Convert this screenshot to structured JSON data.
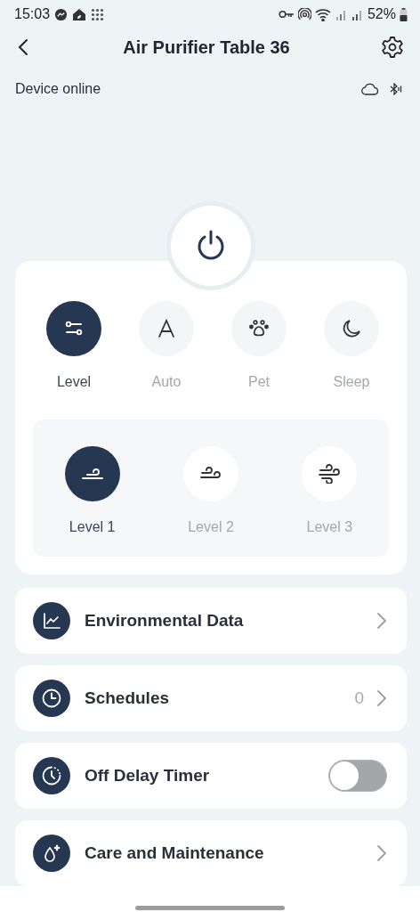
{
  "status_bar": {
    "time": "15:03",
    "battery": "52%"
  },
  "header": {
    "title": "Air Purifier Table 36"
  },
  "device": {
    "status": "Device online"
  },
  "modes": [
    {
      "label": "Level",
      "kind": "level",
      "selected": true
    },
    {
      "label": "Auto",
      "kind": "auto",
      "selected": false
    },
    {
      "label": "Pet",
      "kind": "pet",
      "selected": false
    },
    {
      "label": "Sleep",
      "kind": "sleep",
      "selected": false
    }
  ],
  "levels": [
    {
      "label": "Level 1",
      "kind": "wind1",
      "selected": true
    },
    {
      "label": "Level 2",
      "kind": "wind2",
      "selected": false
    },
    {
      "label": "Level 3",
      "kind": "wind3",
      "selected": false
    }
  ],
  "menu": [
    {
      "label": "Environmental Data",
      "kind": "chart"
    },
    {
      "label": "Schedules",
      "kind": "clock",
      "count": "0"
    },
    {
      "label": "Off Delay Timer",
      "kind": "timer",
      "on": false
    },
    {
      "label": "Care and Maintenance",
      "kind": "drop"
    }
  ]
}
